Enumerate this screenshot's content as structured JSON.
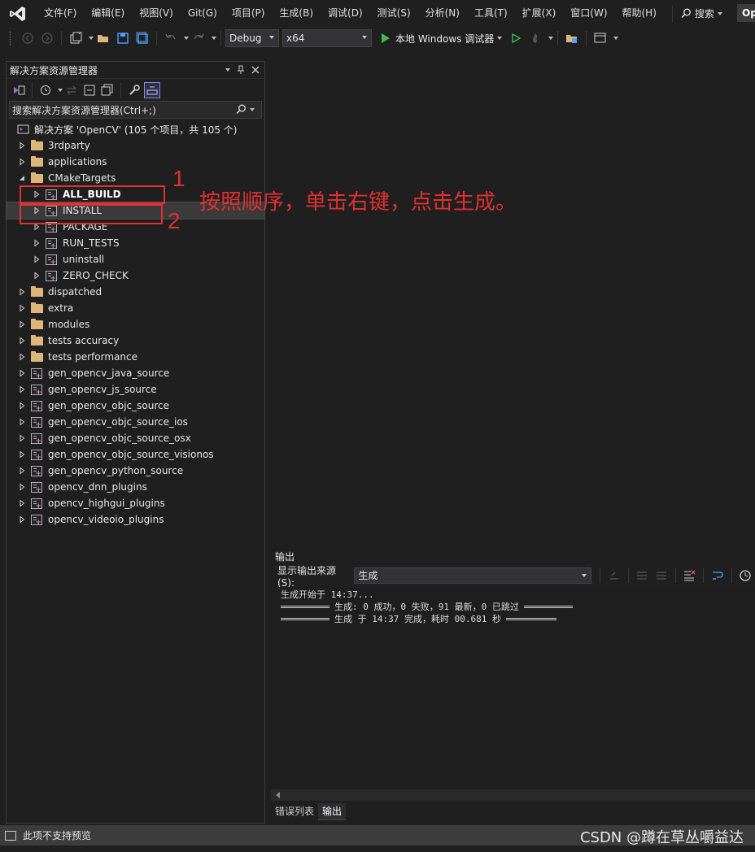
{
  "menubar": {
    "items": [
      "文件(F)",
      "编辑(E)",
      "视图(V)",
      "Git(G)",
      "项目(P)",
      "生成(B)",
      "调试(D)",
      "测试(S)",
      "分析(N)",
      "工具(T)",
      "扩展(X)",
      "窗口(W)",
      "帮助(H)"
    ],
    "search_label": "搜索",
    "title_fragment": "Op"
  },
  "toolbar": {
    "config": "Debug",
    "platform": "x64",
    "run_label": "本地 Windows 调试器"
  },
  "solution_explorer": {
    "title": "解决方案资源管理器",
    "search_placeholder": "搜索解决方案资源管理器(Ctrl+;)",
    "solution_label": "解决方案 'OpenCV' (105 个项目，共 105 个)",
    "items": [
      {
        "label": "3rdparty",
        "type": "folder",
        "level": 1
      },
      {
        "label": "applications",
        "type": "folder",
        "level": 1
      },
      {
        "label": "CMakeTargets",
        "type": "folder",
        "level": 1,
        "expanded": true
      },
      {
        "label": "ALL_BUILD",
        "type": "project",
        "level": 2,
        "bold": true
      },
      {
        "label": "INSTALL",
        "type": "project",
        "level": 2,
        "selected": true
      },
      {
        "label": "PACKAGE",
        "type": "project",
        "level": 2
      },
      {
        "label": "RUN_TESTS",
        "type": "project",
        "level": 2
      },
      {
        "label": "uninstall",
        "type": "project",
        "level": 2
      },
      {
        "label": "ZERO_CHECK",
        "type": "project",
        "level": 2
      },
      {
        "label": "dispatched",
        "type": "folder",
        "level": 1
      },
      {
        "label": "extra",
        "type": "folder",
        "level": 1
      },
      {
        "label": "modules",
        "type": "folder",
        "level": 1
      },
      {
        "label": "tests accuracy",
        "type": "folder",
        "level": 1
      },
      {
        "label": "tests performance",
        "type": "folder",
        "level": 1
      },
      {
        "label": "gen_opencv_java_source",
        "type": "project",
        "level": 1
      },
      {
        "label": "gen_opencv_js_source",
        "type": "project",
        "level": 1
      },
      {
        "label": "gen_opencv_objc_source",
        "type": "project",
        "level": 1
      },
      {
        "label": "gen_opencv_objc_source_ios",
        "type": "project",
        "level": 1
      },
      {
        "label": "gen_opencv_objc_source_osx",
        "type": "project",
        "level": 1
      },
      {
        "label": "gen_opencv_objc_source_visionos",
        "type": "project",
        "level": 1
      },
      {
        "label": "gen_opencv_python_source",
        "type": "project",
        "level": 1
      },
      {
        "label": "opencv_dnn_plugins",
        "type": "project",
        "level": 1
      },
      {
        "label": "opencv_highgui_plugins",
        "type": "project",
        "level": 1
      },
      {
        "label": "opencv_videoio_plugins",
        "type": "project",
        "level": 1
      }
    ]
  },
  "annotation": {
    "num1": "1",
    "num2": "2",
    "text": "按照顺序，单击右键，点击生成。",
    "color": "#e03030"
  },
  "output": {
    "title": "输出",
    "source_label": "显示输出来源(S):",
    "source_value": "生成",
    "lines": [
      "生成开始于 14:37...",
      "生成: 0 成功，0 失败，91 最新，0 已跳过",
      "生成 于 14:37 完成，耗时 00.681 秒"
    ],
    "tabs": [
      "错误列表",
      "输出"
    ]
  },
  "status": {
    "text": "此项不支持预览"
  },
  "watermark": "CSDN @蹲在草丛嚼益达",
  "colors": {
    "background": "#1f1f1f",
    "accent": "#3fb950",
    "folder": "#dcb67a",
    "annotation": "#e03030"
  }
}
